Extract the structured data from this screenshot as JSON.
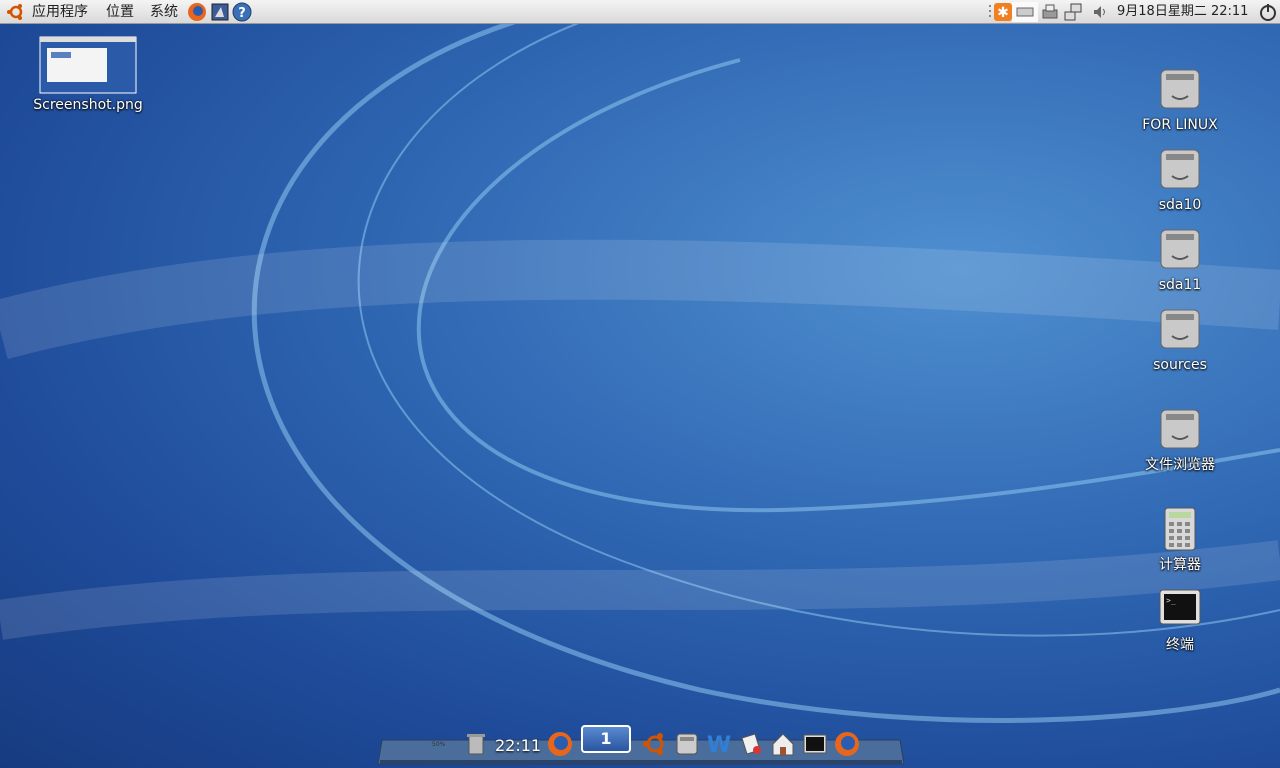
{
  "top_panel": {
    "menus": [
      "应用程序",
      "位置",
      "系统"
    ],
    "clock": "9月18日星期二 22:11"
  },
  "desktop": {
    "left_icons": [
      {
        "label": "Screenshot.png",
        "type": "image-thumbnail"
      }
    ],
    "right_icons": [
      {
        "label": "FOR LINUX",
        "type": "drive-icon"
      },
      {
        "label": "sda10",
        "type": "drive-icon"
      },
      {
        "label": "sda11",
        "type": "drive-icon"
      },
      {
        "label": "sources",
        "type": "drive-icon"
      },
      {
        "label": "文件浏览器",
        "type": "drive-icon"
      },
      {
        "label": "计算器",
        "type": "calculator-icon"
      },
      {
        "label": "终端",
        "type": "terminal-icon"
      }
    ]
  },
  "dock": {
    "clock": "22:11",
    "workspace": "1",
    "percent": "50%",
    "items": [
      "trash-icon",
      "firefox-icon",
      "ubuntu-icon",
      "drive-icon",
      "writer-icon",
      "notes-icon",
      "home-icon",
      "terminal-icon",
      "firefox-icon"
    ]
  },
  "colors": {
    "accent": "#2d64b0",
    "panel": "#e6e6e6"
  }
}
